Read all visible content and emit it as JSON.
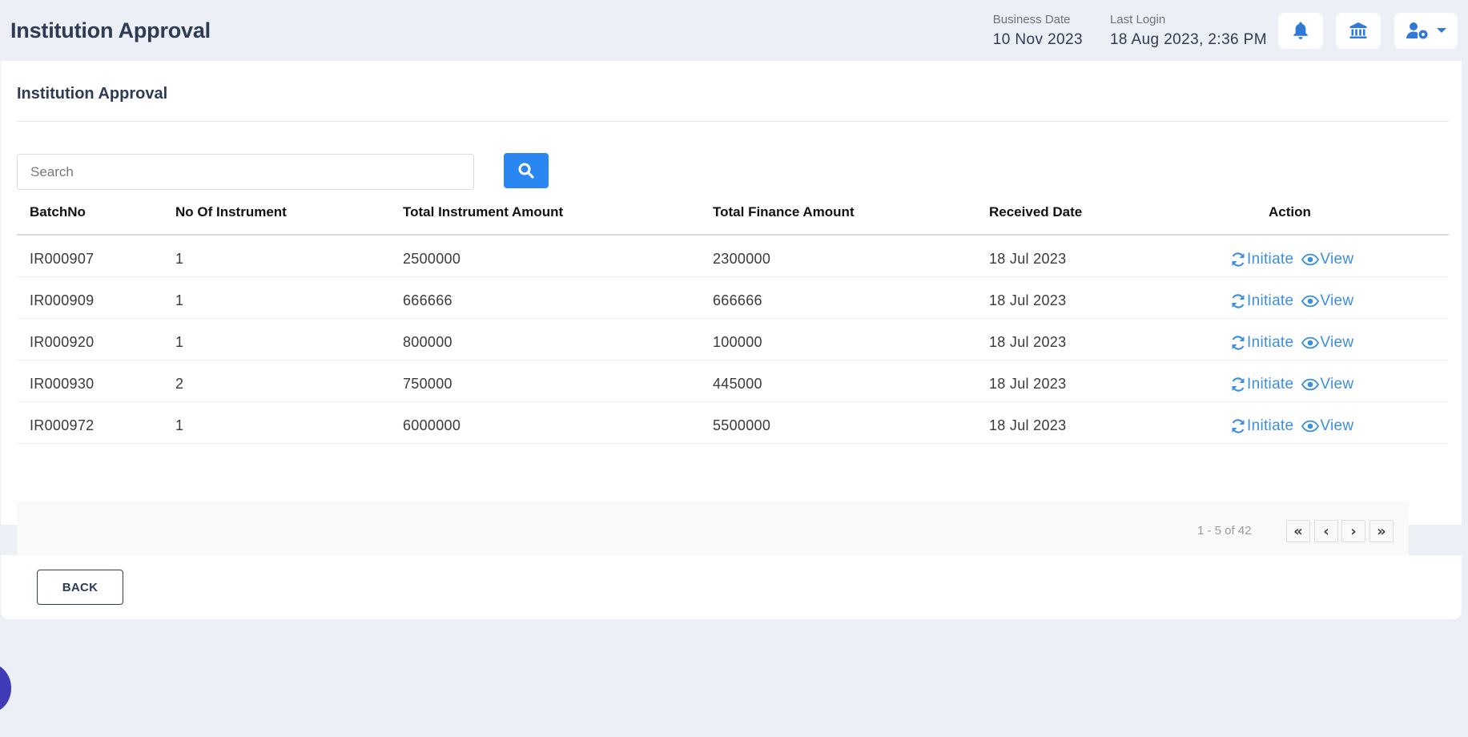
{
  "header": {
    "title": "Institution Approval",
    "business_date_label": "Business Date",
    "business_date": "10 Nov 2023",
    "last_login_label": "Last Login",
    "last_login": "18 Aug 2023, 2:36 PM",
    "icons": [
      "bell-icon",
      "bank-icon",
      "user-settings-icon",
      "caret-down-icon"
    ]
  },
  "card": {
    "title": "Institution Approval",
    "search_placeholder": "Search"
  },
  "table": {
    "columns": [
      "BatchNo",
      "No Of Instrument",
      "Total Instrument Amount",
      "Total Finance Amount",
      "Received Date",
      "Action"
    ],
    "rows": [
      {
        "batch": "IR000907",
        "count": "1",
        "instrument_amount": "2500000",
        "finance_amount": "2300000",
        "date": "18 Jul 2023"
      },
      {
        "batch": "IR000909",
        "count": "1",
        "instrument_amount": "666666",
        "finance_amount": "666666",
        "date": "18 Jul 2023"
      },
      {
        "batch": "IR000920",
        "count": "1",
        "instrument_amount": "800000",
        "finance_amount": "100000",
        "date": "18 Jul 2023"
      },
      {
        "batch": "IR000930",
        "count": "2",
        "instrument_amount": "750000",
        "finance_amount": "445000",
        "date": "18 Jul 2023"
      },
      {
        "batch": "IR000972",
        "count": "1",
        "instrument_amount": "6000000",
        "finance_amount": "5500000",
        "date": "18 Jul 2023"
      }
    ],
    "action_initiate": "Initiate",
    "action_view": "View"
  },
  "pagination": {
    "info": "1 - 5 of 42",
    "first": "«",
    "prev": "‹",
    "next": "›",
    "last": "»"
  },
  "footer": {
    "back_label": "BACK"
  },
  "colors": {
    "accent": "#2a86f0",
    "link": "#3b8fe0",
    "title": "#2e3b55",
    "background": "#eceff5"
  }
}
